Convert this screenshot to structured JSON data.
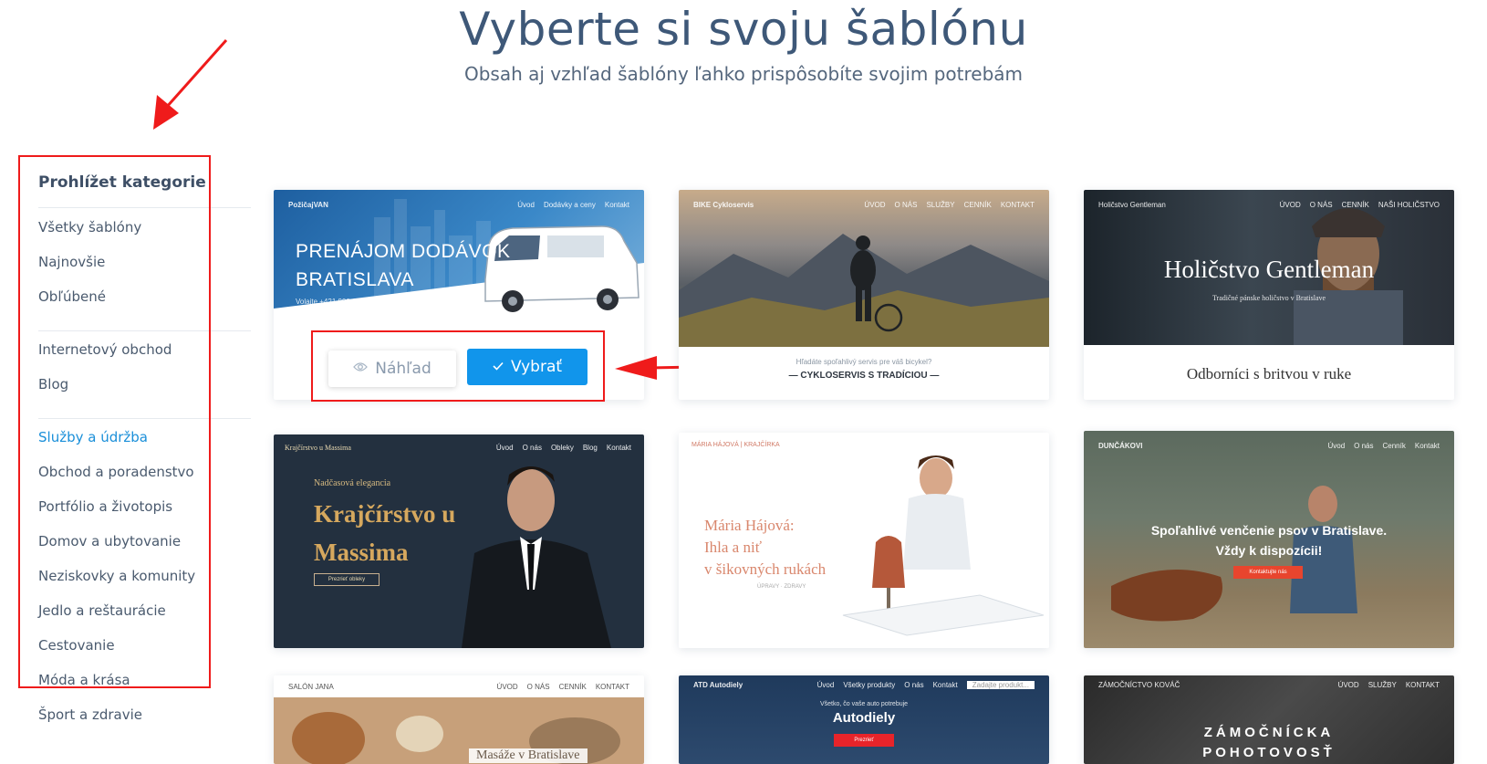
{
  "header": {
    "title": "Vyberte si svoju šablónu",
    "subtitle": "Obsah aj vzhľad šablóny ľahko prispôsobíte svojim potrebám"
  },
  "sidebar": {
    "heading": "Prohlížet kategorie",
    "items": [
      {
        "label": "Všetky šablóny"
      },
      {
        "label": "Najnovšie"
      },
      {
        "label": "Obľúbené"
      },
      {
        "label": "Internetový obchod"
      },
      {
        "label": "Blog"
      },
      {
        "label": "Služby a údržba",
        "active": true
      },
      {
        "label": "Obchod a poradenstvo"
      },
      {
        "label": "Portfólio a životopis"
      },
      {
        "label": "Domov a ubytovanie"
      },
      {
        "label": "Neziskovky a komunity"
      },
      {
        "label": "Jedlo a reštaurácie"
      },
      {
        "label": "Cestovanie"
      },
      {
        "label": "Móda a krása"
      },
      {
        "label": "Šport a zdravie"
      }
    ]
  },
  "actions": {
    "preview_label": "Náhľad",
    "select_label": "Vybrať"
  },
  "templates": [
    {
      "brand": "PožičajVAN",
      "nav": [
        "Úvod",
        "Dodávky a ceny",
        "Kontakt"
      ],
      "headline_1": "PRENÁJOM DODÁVOK",
      "headline_2": "BRATISLAVA",
      "phone": "Volajte +421 900 123 123"
    },
    {
      "brand": "BIKE Cykloservis",
      "nav": [
        "ÚVOD",
        "O NÁS",
        "SLUŽBY",
        "CENNÍK",
        "KONTAKT"
      ],
      "tagline": "— CYKLOSERVIS S TRADÍCIOU —",
      "small_line": "Hľadáte spoľahlivý servis pre váš bicykel?"
    },
    {
      "brand": "Holičstvo Gentleman",
      "nav": [
        "ÚVOD",
        "O NÁS",
        "CENNÍK",
        "NAŠI HOLIČSTVO"
      ],
      "headline": "Holičstvo Gentleman",
      "sub": "Tradičné pánske holičstvo v Bratislave",
      "strip_title": "Odborníci s britvou v ruke"
    },
    {
      "brand": "Krajčírstvo u Massima",
      "nav": [
        "Úvod",
        "O nás",
        "Obleky",
        "Blog",
        "Kontakt"
      ],
      "eyebrow": "Nadčasová elegancia",
      "headline_1": "Krajčírstvo u",
      "headline_2": "Massima",
      "button": "Prezrieť obleky"
    },
    {
      "brand": "MÁRIA HÁJOVÁ | KRAJČÍRKA",
      "headline_1": "Mária Hájová:",
      "headline_2": "Ihla a niť",
      "headline_3": "v šikovných rukách",
      "sub": "ÚPRAVY · ZDRAVY"
    },
    {
      "brand": "DUNČÁKOVI",
      "nav": [
        "Úvod",
        "O nás",
        "Cenník",
        "Kontakt"
      ],
      "headline_1": "Spoľahlivé venčenie psov v Bratislave.",
      "headline_2": "Vždy k dispozícii!",
      "button": "Kontaktujte nás"
    },
    {
      "brand": "SALÓN JANA",
      "nav": [
        "ÚVOD",
        "O NÁS",
        "CENNÍK",
        "KONTAKT"
      ],
      "headline": "Masáže v Bratislave"
    },
    {
      "brand": "ATD Autodiely",
      "nav": [
        "Úvod",
        "Všetky produkty",
        "O nás",
        "Kontakt"
      ],
      "search_placeholder": "Zadajte produkt...",
      "small_line": "Všetko, čo vaše auto potrebuje",
      "headline": "Autodiely",
      "button": "Prezrieť"
    },
    {
      "brand": "ZÁMOČNÍCTVO KOVÁČ",
      "nav": [
        "ÚVOD",
        "SLUŽBY",
        "KONTAKT"
      ],
      "headline_1": "ZÁMOČNÍCKA",
      "headline_2": "POHOTOVOSŤ"
    }
  ]
}
